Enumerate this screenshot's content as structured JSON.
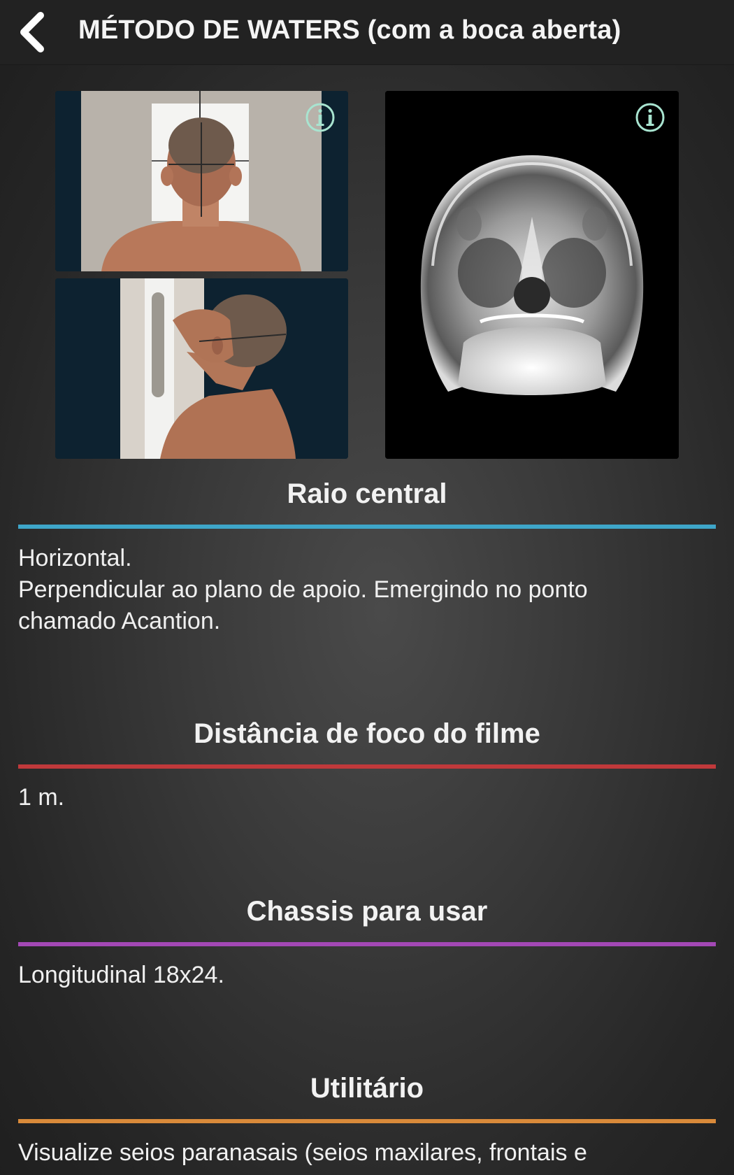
{
  "header": {
    "title": "MÉTODO DE WATERS (com a boca aberta)"
  },
  "colors": {
    "raio_central": "#3ea6c9",
    "distancia": "#c0393b",
    "chassis": "#a348b5",
    "utilitario": "#d98a3a",
    "info_icon": "#a8e4d0"
  },
  "sections": [
    {
      "title": "Raio central",
      "lines": [
        "Horizontal.",
        "Perpendicular ao plano de apoio. Emergindo no ponto",
        "chamado Acantion."
      ]
    },
    {
      "title": "Distância de foco do filme",
      "lines": [
        "1 m."
      ]
    },
    {
      "title": "Chassis para usar",
      "lines": [
        "Longitudinal 18x24."
      ]
    },
    {
      "title": "Utilitário",
      "lines": [
        "Visualize seios paranasais (seios maxilares, frontais e"
      ]
    }
  ]
}
